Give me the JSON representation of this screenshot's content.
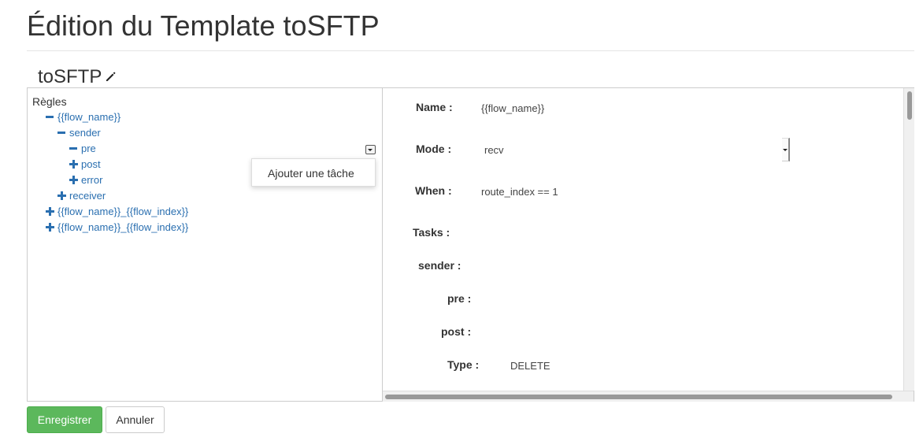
{
  "page": {
    "title": "Édition du Template toSFTP"
  },
  "template": {
    "name": "toSFTP",
    "edit_icon": "pencil-icon"
  },
  "tree": {
    "root_label": "Règles",
    "nodes": [
      {
        "label": "{{flow_name}}",
        "state": "expanded"
      },
      {
        "label": "sender",
        "state": "expanded"
      },
      {
        "label": "pre",
        "state": "expanded"
      },
      {
        "label": "post",
        "state": "collapsed"
      },
      {
        "label": "error",
        "state": "collapsed"
      },
      {
        "label": "receiver",
        "state": "collapsed"
      },
      {
        "label": "{{flow_name}}_{{flow_index}}",
        "state": "collapsed"
      },
      {
        "label": "{{flow_name}}_{{flow_index}}",
        "state": "collapsed"
      }
    ],
    "context_menu": {
      "item": "Ajouter une tâche"
    }
  },
  "form": {
    "name_label": "Name :",
    "name_value": "{{flow_name}}",
    "mode_label": "Mode :",
    "mode_value": "recv",
    "when_label": "When :",
    "when_value": "route_index == 1",
    "tasks_label": "Tasks :",
    "sender_label": "sender :",
    "pre_label": "pre :",
    "post_label": "post :",
    "type_label": "Type :",
    "type_value": "DELETE"
  },
  "buttons": {
    "save": "Enregistrer",
    "cancel": "Annuler"
  },
  "colors": {
    "link": "#2a6fb0",
    "save": "#5cb85c"
  }
}
